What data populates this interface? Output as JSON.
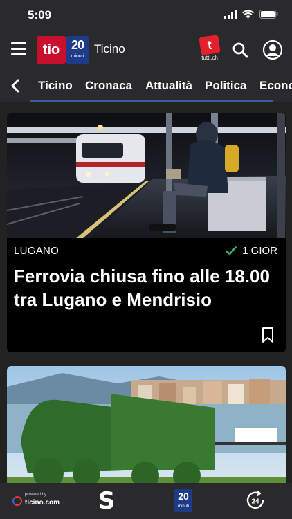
{
  "status": {
    "time": "5:09"
  },
  "header": {
    "logo_tio": "tio",
    "logo_20": "20",
    "logo_20_sub": "minuti",
    "title": "Ticino",
    "tutti_badge": "t",
    "tutti_label": "tutti.ch"
  },
  "tabs": [
    {
      "label": "Ticino"
    },
    {
      "label": "Cronaca"
    },
    {
      "label": "Attualità"
    },
    {
      "label": "Politica"
    },
    {
      "label": "Econo"
    }
  ],
  "articles": [
    {
      "location": "LUGANO",
      "time": "1 GIOR",
      "title": "Ferrovia chiusa fino alle 18.00 tra Lugano e Mendrisio"
    }
  ],
  "bottom_bar": {
    "ticino_small": "powered by",
    "ticino_big": "ticino.com",
    "s_label": "S",
    "logo_20": "20",
    "logo_20_sub": "minuti",
    "clock_label": "24"
  },
  "colors": {
    "brand_red": "#c8102e",
    "brand_blue": "#1e3b8a",
    "tab_underline": "#41599e",
    "check_green": "#3bb26b"
  }
}
